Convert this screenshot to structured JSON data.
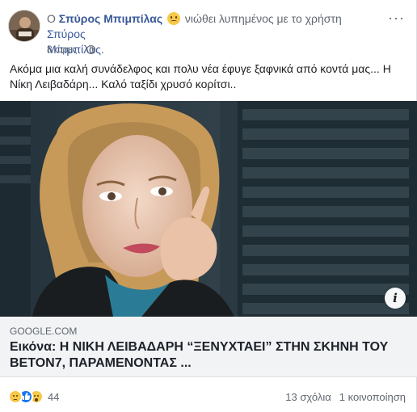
{
  "post": {
    "author": "Σπύρος Μπιμπίλας",
    "feeling_text": "νιώθει λυπημένος με το χρήστη",
    "tagged_user_line1": "Σπύρος",
    "tagged_user_line2": "Μπιμπίλας.",
    "prefix": "Ο",
    "time": "8 ώρες",
    "time_separator": "·",
    "more_glyph": "···",
    "text": "Ακόμα μια καλή συνάδελφος και πολυ νέα έφυγε ξαφνικά από κοντά μας... Η Νίκη Λειβαδάρη... Καλό ταξίδι χρυσό κορίτσι..",
    "feeling_icon": "sad-face-icon",
    "privacy_icon": "globe-icon"
  },
  "link_preview": {
    "source": "GOOGLE.COM",
    "headline": "Εικόνα: Η ΝΙΚΗ ΛΕΙΒΑΔΑΡΗ “ΞΕΝΥΧΤΑΕΙ” ΣΤΗΝ ΣΚΗΝΗ ΤΟΥ ΒΕΤΟΝ7, ΠΑΡΑΜΕΝΟΝΤΑΣ ...",
    "info_glyph": "i"
  },
  "footer": {
    "reaction_count": "44",
    "comments": "13 σχόλια",
    "shares": "1 κοινοποίηση",
    "reactions": [
      "sad-reaction-icon",
      "like-reaction-icon",
      "wow-reaction-icon"
    ]
  },
  "colors": {
    "link": "#385898",
    "meta": "#616770",
    "linkbox_bg": "#f2f3f5",
    "like_blue": "#1877f2"
  }
}
